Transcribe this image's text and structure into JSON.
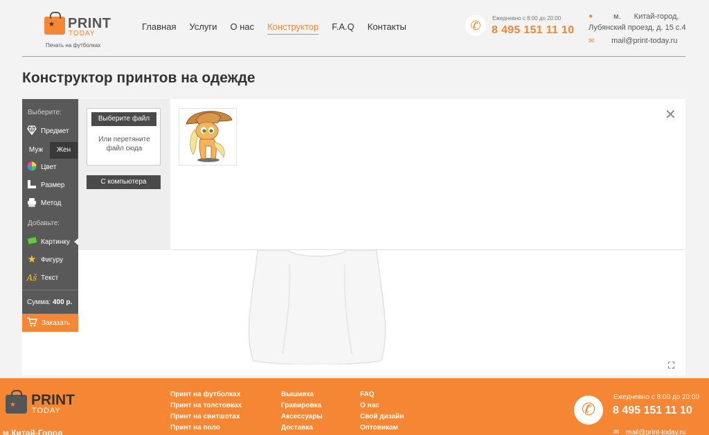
{
  "header": {
    "logo": {
      "print": "PRINT",
      "today": "TODAY",
      "subtitle": "Печать на футболках"
    },
    "nav": [
      {
        "label": "Главная"
      },
      {
        "label": "Услуги"
      },
      {
        "label": "О нас"
      },
      {
        "label": "Конструктор",
        "active": true
      },
      {
        "label": "F.A.Q"
      },
      {
        "label": "Контакты"
      }
    ],
    "contact": {
      "hours": "Ежедневно с 8:00 до 20:00",
      "phone": "8 495 151 11 10",
      "address_line1": "м. Китай-город,",
      "address_line2": "Лубянский проезд, д. 15 с.4",
      "email": "mail@print-today.ru"
    }
  },
  "page": {
    "title": "Конструктор принтов на одежде"
  },
  "sidebar": {
    "choose_label": "Выберите:",
    "add_label": "Добавьте:",
    "items": {
      "product": "Предмет",
      "color": "Цвет",
      "size": "Размер",
      "method": "Метод",
      "pictures": "Картинку",
      "shapes": "Фигуру",
      "text": "Текст"
    },
    "gender": {
      "male": "Муж",
      "female": "Жен",
      "selected": "female"
    },
    "sum_label": "Сумма:",
    "sum_value": "400 р.",
    "order_label": "Заказать"
  },
  "upload": {
    "choose_file": "Выберите файл",
    "drop_hint": "Или перетяните файл сюда",
    "from_computer": "С компьютера"
  },
  "icons": {
    "close": "close-icon",
    "fullscreen": "fullscreen-icon"
  },
  "footer": {
    "logo": {
      "print": "PRINT",
      "today": "TODAY"
    },
    "metro": "м.Китай-Город",
    "col1": [
      "Принт на футболках",
      "Принт на толстовках",
      "Принт на свитшотах",
      "Принт на поло"
    ],
    "col2": [
      "Вышивка",
      "Гравировка",
      "Аксессуары",
      "Доставка"
    ],
    "col3": [
      "FAQ",
      "О нас",
      "Свой дизайн",
      "Оптовикам"
    ],
    "hours": "Ежедневно с 8:00 до 20:00",
    "phone": "8 495 151 11 10",
    "email": "mail@print-today.ru"
  },
  "colors": {
    "accent": "#f58634",
    "sidebar": "#595959",
    "text": "#333333"
  }
}
